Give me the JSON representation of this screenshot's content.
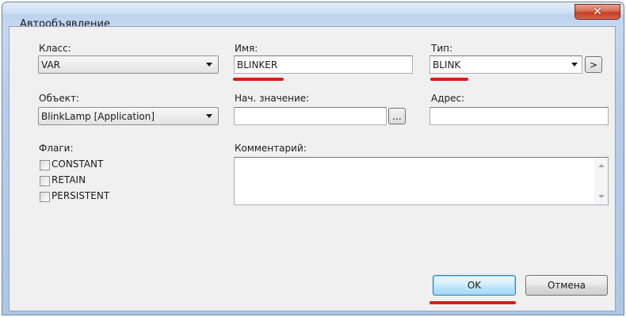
{
  "window": {
    "title": "Автообъявление",
    "close_glyph": "✕"
  },
  "form": {
    "class_label": "Класс:",
    "class_value": "VAR",
    "name_label": "Имя:",
    "name_value": "BLINKER",
    "type_label": "Тип:",
    "type_value": "BLINK",
    "type_browse_label": ">",
    "object_label": "Объект:",
    "object_value": "BlinkLamp [Application]",
    "init_label": "Нач. значение:",
    "init_value": "",
    "init_browse_label": "...",
    "address_label": "Адрес:",
    "address_value": "",
    "flags_label": "Флаги:",
    "flags": [
      {
        "label": "CONSTANT",
        "checked": false
      },
      {
        "label": "RETAIN",
        "checked": false
      },
      {
        "label": "PERSISTENT",
        "checked": false
      }
    ],
    "comment_label": "Комментарий:",
    "comment_value": ""
  },
  "buttons": {
    "ok_label": "OK",
    "cancel_label": "Отмена"
  },
  "colors": {
    "highlight": "#e01a1a",
    "default_button_border": "#3c7fb1"
  }
}
